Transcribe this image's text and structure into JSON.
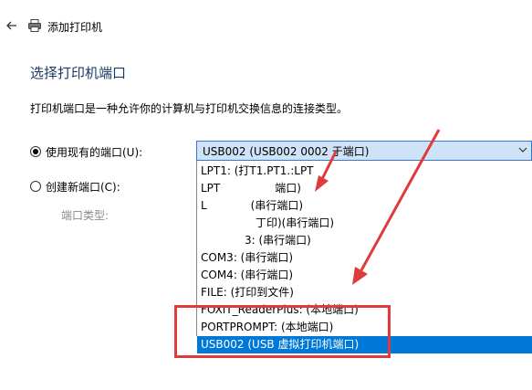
{
  "window": {
    "title": "添加打印机"
  },
  "page": {
    "heading": "选择打印机端口",
    "description": "打印机端口是一种允许你的计算机与打印机交换信息的连接类型。"
  },
  "options": {
    "use_existing": {
      "label": "使用现有的端口(U):",
      "checked": true
    },
    "create_new": {
      "label": "创建新端口(C):",
      "checked": false
    },
    "port_type_label": "端口类型:"
  },
  "port_select": {
    "selected_value": "USB002 (USB002 0002 于端口)",
    "items": [
      "LPT1: (打T1.PT1.:LPT",
      "LPT　　　　　端口)",
      "L　　　　(串行端口)",
      "　　　　　丁印)(串行端口)",
      "　　　　3: (串行端口)",
      "COM3: (串行端口)",
      "COM4: (串行端口)",
      "FILE: (打印到文件)",
      "FOXIT_ReaderPlus: (本地端口)",
      "PORTPROMPT: (本地端口)",
      "USB002 (USB 虚拟打印机端口)"
    ],
    "selected_index": 10
  },
  "colors": {
    "accent": "#0078d7",
    "select_bg": "#cfe3f8",
    "annotation": "#e03a3a",
    "heading": "#1a3a66"
  }
}
